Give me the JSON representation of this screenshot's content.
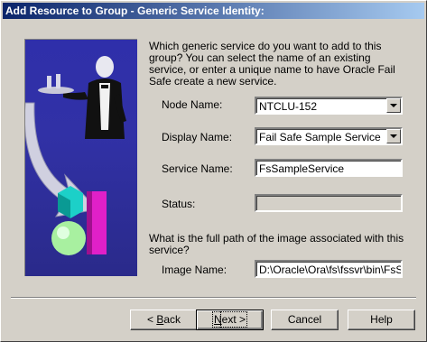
{
  "window": {
    "title": "Add Resource to Group - Generic Service Identity:"
  },
  "intro": "Which generic service do you want to add to this group? You can select the name of an existing service, or enter a unique name to have Oracle Fail Safe create a new service.",
  "fields": {
    "node_name": {
      "label": "Node Name:",
      "value": "NTCLU-152"
    },
    "display_name": {
      "label": "Display Name:",
      "value": "Fail Safe Sample Service"
    },
    "service_name": {
      "label": "Service Name:",
      "value": "FsSampleService"
    },
    "status": {
      "label": "Status:",
      "value": ""
    },
    "image_name": {
      "label": "Image Name:",
      "value": "D:\\Oracle\\Ora\\fs\\fssvr\\bin\\FsSan"
    }
  },
  "image_question": "What is the full path of the image associated with this service?",
  "buttons": {
    "back": {
      "mnemonic": "B",
      "rest": "ack",
      "prefix": "< "
    },
    "next": {
      "mnemonic": "N",
      "rest": "ext >"
    },
    "cancel": "Cancel",
    "help": "Help"
  },
  "colors": {
    "title_start": "#0a246a",
    "title_end": "#a6caf0",
    "dialog_bg": "#d4d0c8"
  }
}
